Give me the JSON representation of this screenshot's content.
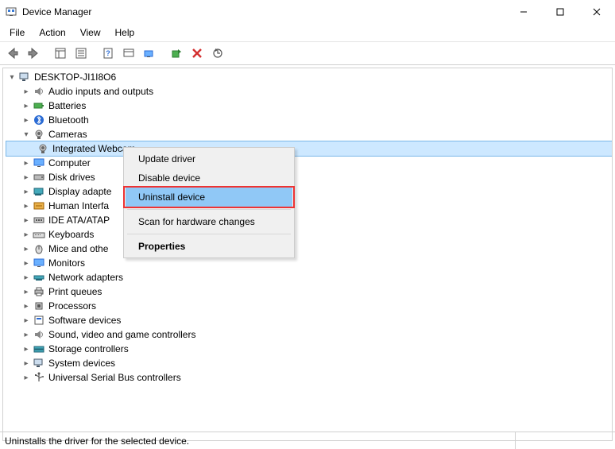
{
  "title": "Device Manager",
  "menu": {
    "file": "File",
    "action": "Action",
    "view": "View",
    "help": "Help"
  },
  "tree": {
    "root": "DESKTOP-JI1I8O6",
    "cat": {
      "audio": "Audio inputs and outputs",
      "batteries": "Batteries",
      "bluetooth": "Bluetooth",
      "cameras": "Cameras",
      "webcam": "Integrated Webcam",
      "computer": "Computer",
      "disk": "Disk drives",
      "display": "Display adapte",
      "hid": "Human Interfa",
      "ide": "IDE ATA/ATAP",
      "keyboards": "Keyboards",
      "mice": "Mice and othe",
      "monitors": "Monitors",
      "network": "Network adapters",
      "print": "Print queues",
      "proc": "Processors",
      "sw": "Software devices",
      "sound": "Sound, video and game controllers",
      "storage": "Storage controllers",
      "system": "System devices",
      "usb": "Universal Serial Bus controllers"
    }
  },
  "ctx": {
    "update": "Update driver",
    "disable": "Disable device",
    "uninstall": "Uninstall device",
    "scan": "Scan for hardware changes",
    "props": "Properties"
  },
  "status": "Uninstalls the driver for the selected device."
}
